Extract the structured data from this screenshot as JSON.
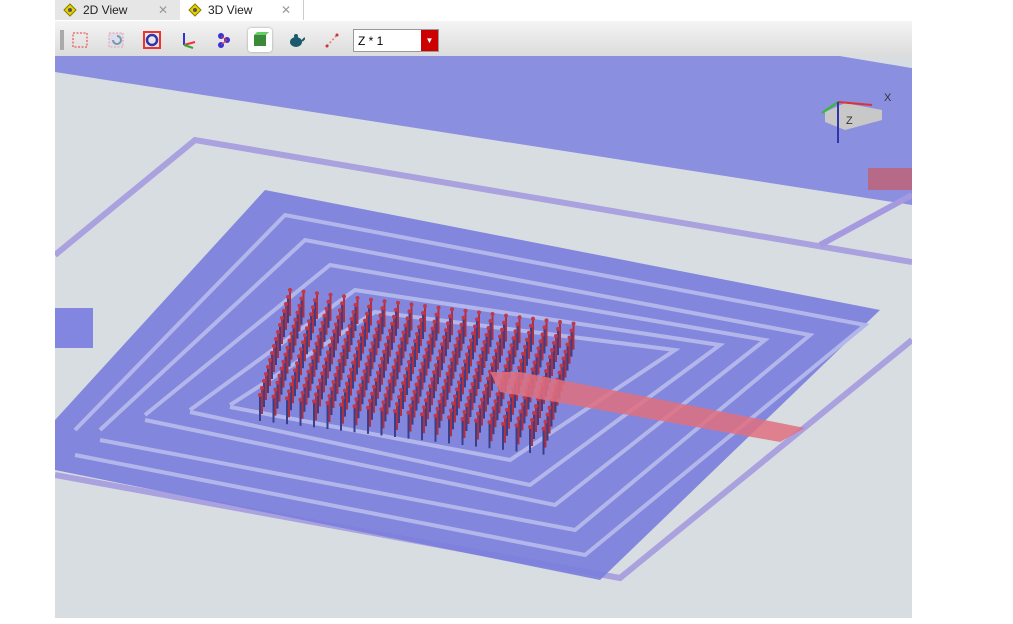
{
  "tabs": [
    {
      "label": "2D View",
      "active": false
    },
    {
      "label": "3D View",
      "active": true
    }
  ],
  "toolbar": {
    "icons": [
      "select-box-icon",
      "rotate-icon",
      "circle-select-icon",
      "axes-icon",
      "molecule-icon",
      "solid-view-icon",
      "teapot-icon",
      "measure-icon"
    ],
    "zscale_value": "Z * 1"
  },
  "axis_indicator": {
    "x_label": "X",
    "z_label": "Z"
  },
  "colors": {
    "plate": "#7b7fdc",
    "via": "#c0384a",
    "background": "#d8dde2"
  }
}
